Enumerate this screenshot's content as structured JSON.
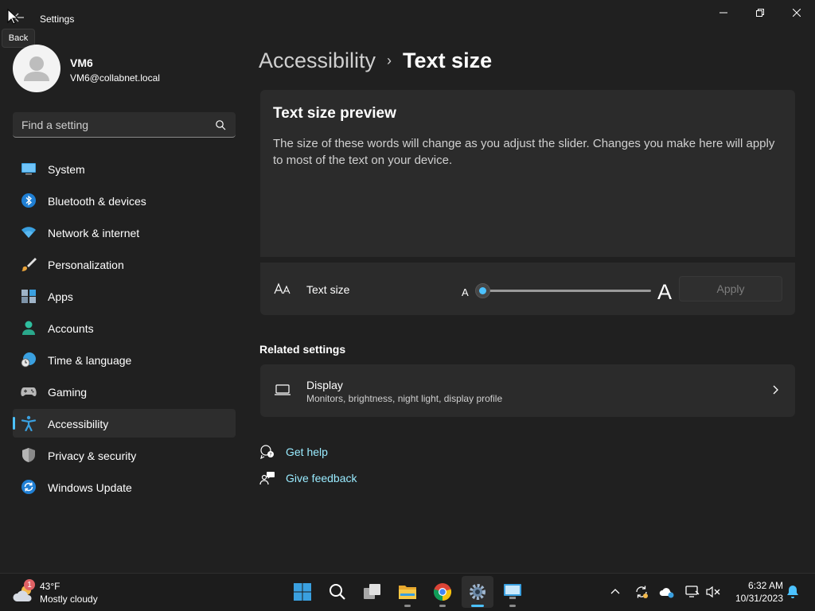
{
  "window": {
    "title": "Settings",
    "back_tooltip": "Back"
  },
  "profile": {
    "name": "VM6",
    "email": "VM6@collabnet.local"
  },
  "search": {
    "placeholder": "Find a setting"
  },
  "sidebar": {
    "items": [
      {
        "label": "System",
        "icon": "system-icon",
        "active": false
      },
      {
        "label": "Bluetooth & devices",
        "icon": "bluetooth-icon",
        "active": false
      },
      {
        "label": "Network & internet",
        "icon": "wifi-icon",
        "active": false
      },
      {
        "label": "Personalization",
        "icon": "brush-icon",
        "active": false
      },
      {
        "label": "Apps",
        "icon": "apps-icon",
        "active": false
      },
      {
        "label": "Accounts",
        "icon": "person-icon",
        "active": false
      },
      {
        "label": "Time & language",
        "icon": "globe-clock-icon",
        "active": false
      },
      {
        "label": "Gaming",
        "icon": "gamepad-icon",
        "active": false
      },
      {
        "label": "Accessibility",
        "icon": "accessibility-icon",
        "active": true
      },
      {
        "label": "Privacy & security",
        "icon": "shield-icon",
        "active": false
      },
      {
        "label": "Windows Update",
        "icon": "update-icon",
        "active": false
      }
    ]
  },
  "breadcrumb": {
    "parent": "Accessibility",
    "separator": "›",
    "current": "Text size"
  },
  "preview": {
    "title": "Text size preview",
    "body": "The size of these words will change as you adjust the slider. Changes you make here will apply to most of the text on your device."
  },
  "text_size": {
    "label": "Text size",
    "min_label": "A",
    "max_label": "A",
    "value_fraction": 0.0,
    "apply_label": "Apply",
    "apply_enabled": false
  },
  "related": {
    "title": "Related settings",
    "display_title": "Display",
    "display_desc": "Monitors, brightness, night light, display profile"
  },
  "links": {
    "help": "Get help",
    "feedback": "Give feedback"
  },
  "taskbar": {
    "weather_badge": "1",
    "weather_temp": "43°F",
    "weather_condition": "Mostly cloudy",
    "time": "6:32 AM",
    "date": "10/31/2023"
  },
  "colors": {
    "accent": "#4cc2ff",
    "background": "#202020",
    "card": "#2b2b2b",
    "link": "#99ebff"
  }
}
